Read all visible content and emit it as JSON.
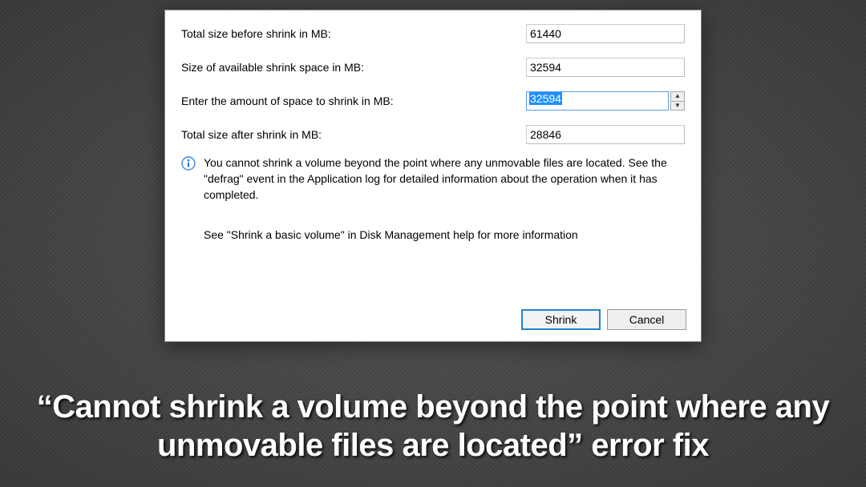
{
  "fields": {
    "total_before": {
      "label": "Total size before shrink in MB:",
      "value": "61440"
    },
    "available": {
      "label": "Size of available shrink space in MB:",
      "value": "32594"
    },
    "enter_amount": {
      "label": "Enter the amount of space to shrink in MB:",
      "value": "32594"
    },
    "total_after": {
      "label": "Total size after shrink in MB:",
      "value": "28846"
    }
  },
  "info": {
    "line1": "You cannot shrink a volume beyond the point where any unmovable files are located. See the \"defrag\" event in the Application log for detailed information about the operation when it has completed.",
    "line2": "See \"Shrink a basic volume\" in Disk Management help for more information"
  },
  "buttons": {
    "shrink": "Shrink",
    "cancel": "Cancel"
  },
  "caption": "“Cannot shrink a volume beyond the point where any unmovable files are located” error fix"
}
